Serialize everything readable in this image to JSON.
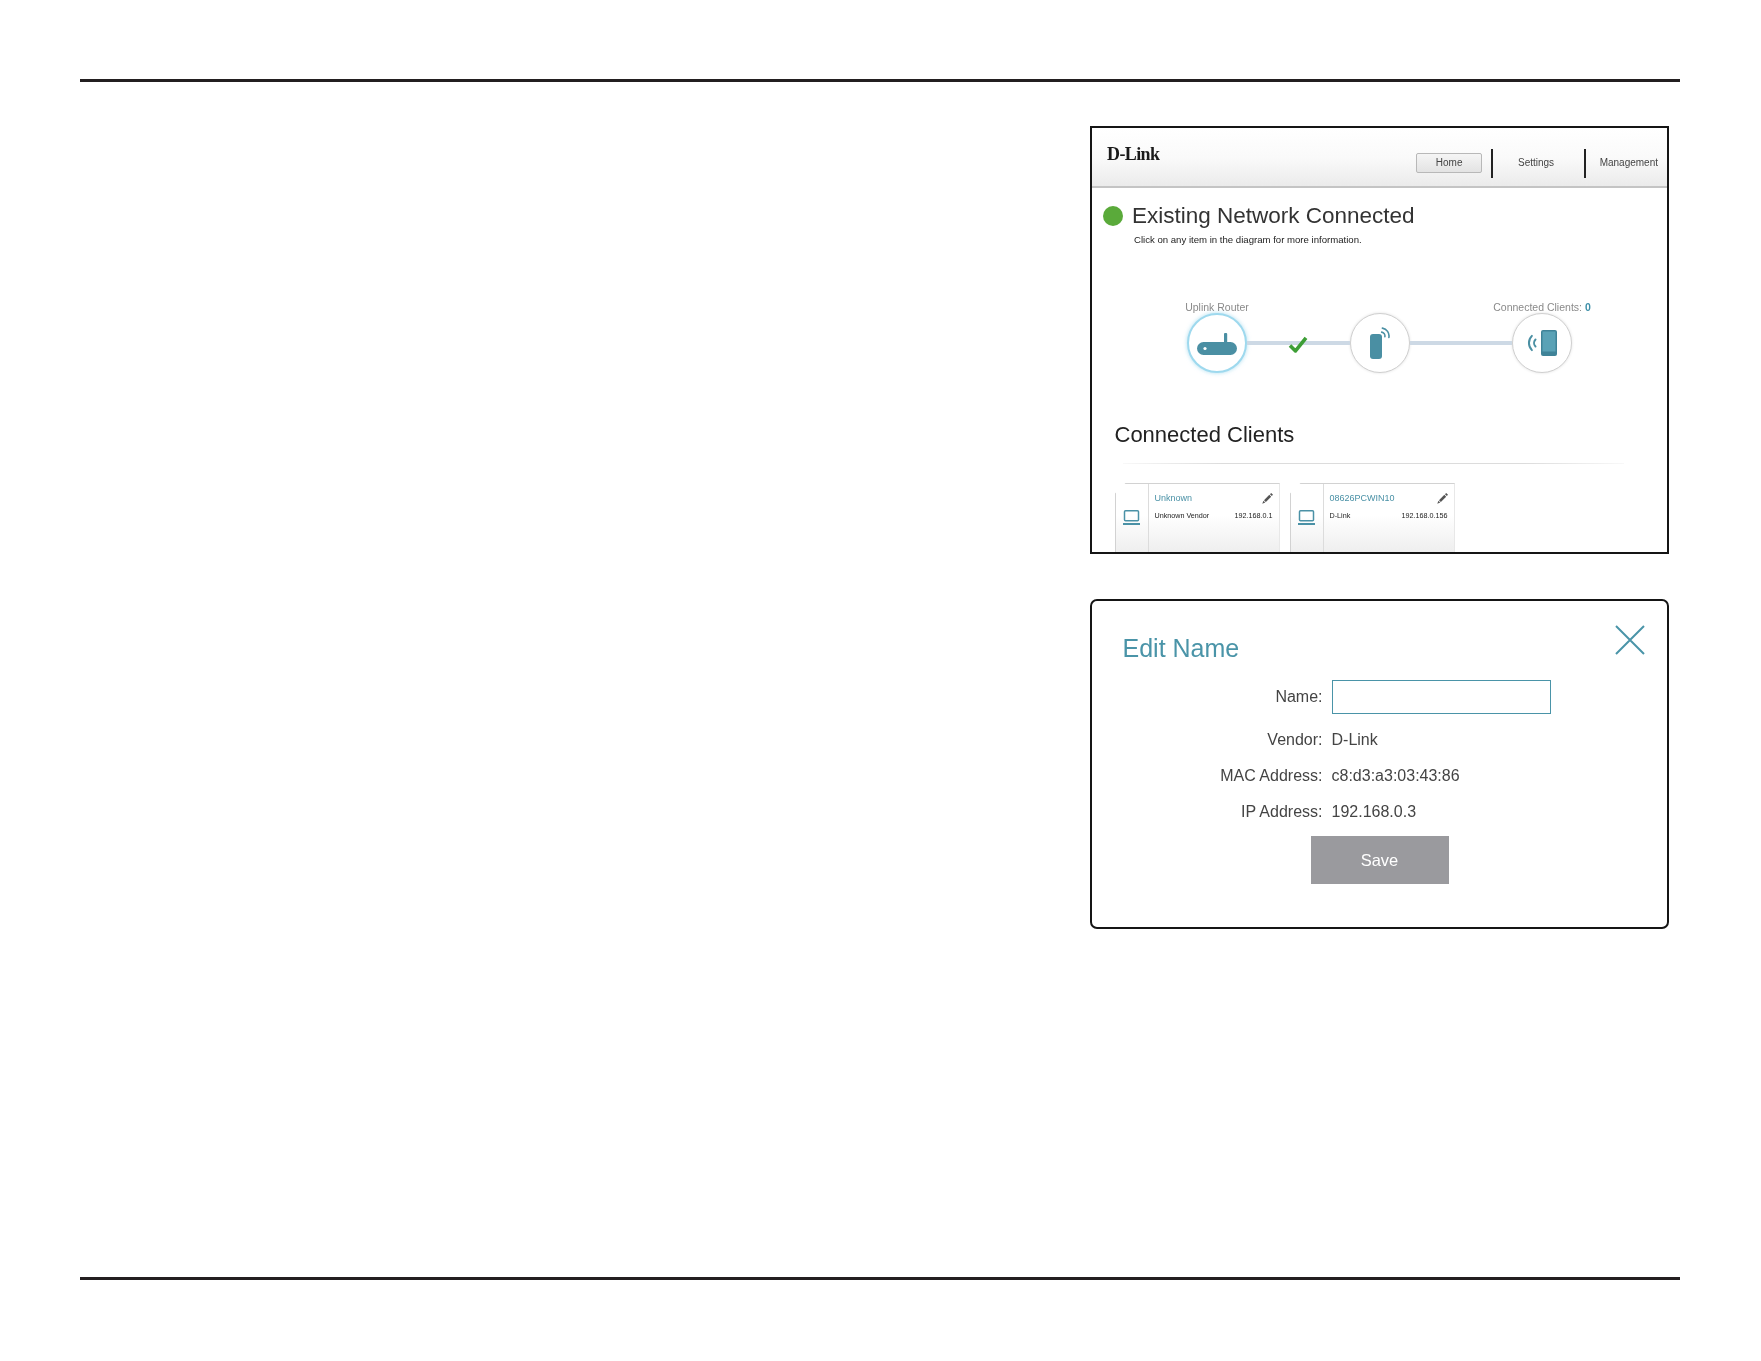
{
  "home_screen": {
    "logo": "D-Link",
    "nav_tabs": [
      {
        "label": "Home",
        "selected": true
      },
      {
        "label": "Settings",
        "selected": false
      },
      {
        "label": "Management",
        "selected": false
      }
    ],
    "status": {
      "connected": true,
      "title": "Existing Network Connected",
      "subtitle": "Click on any item in the diagram for more information."
    },
    "diagram": {
      "nodes": [
        {
          "kind": "router",
          "label": "Uplink Router",
          "selected": true
        },
        {
          "kind": "extender",
          "selected": false
        },
        {
          "kind": "clients",
          "label": "Connected Clients:",
          "count": "0",
          "selected": false
        }
      ],
      "links": [
        {
          "connected": true
        },
        {
          "connected": false
        }
      ]
    },
    "clients": {
      "heading": "Connected Clients",
      "items": [
        {
          "name": "Unknown",
          "vendor": "Unknown Vendor",
          "ip": "192.168.0.1"
        },
        {
          "name": "08626PCWIN10",
          "vendor": "D-Link",
          "ip": "192.168.0.156"
        }
      ]
    }
  },
  "edit_dialog": {
    "title": "Edit Name",
    "fields": [
      {
        "kind": "input",
        "label": "Name:"
      },
      {
        "kind": "text",
        "label": "Vendor:",
        "value": "D-Link"
      },
      {
        "kind": "text",
        "label": "MAC Address:",
        "value": "c8:d3:a3:03:43:86"
      },
      {
        "kind": "text",
        "label": "IP Address:",
        "value": "192.168.0.3"
      }
    ],
    "save_button": "Save"
  }
}
